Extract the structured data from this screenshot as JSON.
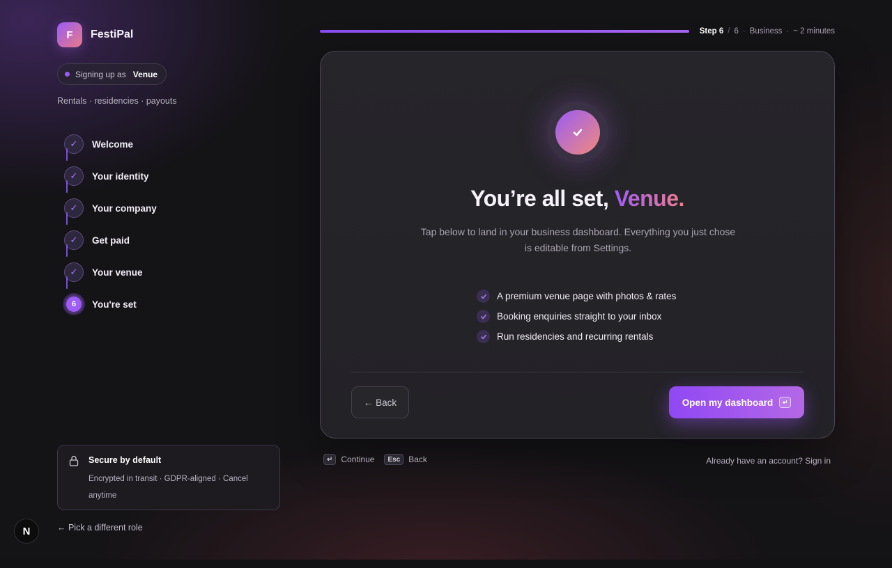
{
  "brand": {
    "logo_letter": "F",
    "name": "FestiPal"
  },
  "role_pill": {
    "prefix": "Signing up as",
    "role": "Venue"
  },
  "tagline": "Rentals · residencies · payouts",
  "steps": [
    {
      "label": "Welcome",
      "state": "done",
      "marker": "✓"
    },
    {
      "label": "Your identity",
      "state": "done",
      "marker": "✓"
    },
    {
      "label": "Your company",
      "state": "done",
      "marker": "✓"
    },
    {
      "label": "Get paid",
      "state": "done",
      "marker": "✓"
    },
    {
      "label": "Your venue",
      "state": "done",
      "marker": "✓"
    },
    {
      "label": "You're set",
      "state": "current",
      "marker": "6"
    }
  ],
  "secure": {
    "title": "Secure by default",
    "text": "Encrypted in transit · GDPR-aligned · Cancel anytime"
  },
  "pick_role": "← Pick a different role",
  "next_badge": "N",
  "progress": {
    "fraction": 1.0,
    "step_label": "Step 6",
    "slash": "/",
    "total": "6",
    "track": "Business",
    "duration": "~ 2 minutes",
    "dot": "·"
  },
  "card": {
    "title_prefix": "You’re all set,",
    "title_accent": "Venue.",
    "subtitle": "Tap below to land in your business dashboard. Everything you just chose is editable from Settings.",
    "features": [
      "A premium venue page with photos & rates",
      "Booking enquiries straight to your inbox",
      "Run residencies and recurring rentals"
    ],
    "back_label": "← Back",
    "primary_label": "Open my dashboard",
    "primary_key": "↵"
  },
  "hints": {
    "continue_key": "↵",
    "continue_label": "Continue",
    "back_key": "Esc",
    "back_label": "Back"
  },
  "signin": "Already have an account? Sign in",
  "colors": {
    "accent": "#9b5cf6",
    "accent_end": "#ef7f8d",
    "background": "#141316",
    "card": "#26252a"
  }
}
